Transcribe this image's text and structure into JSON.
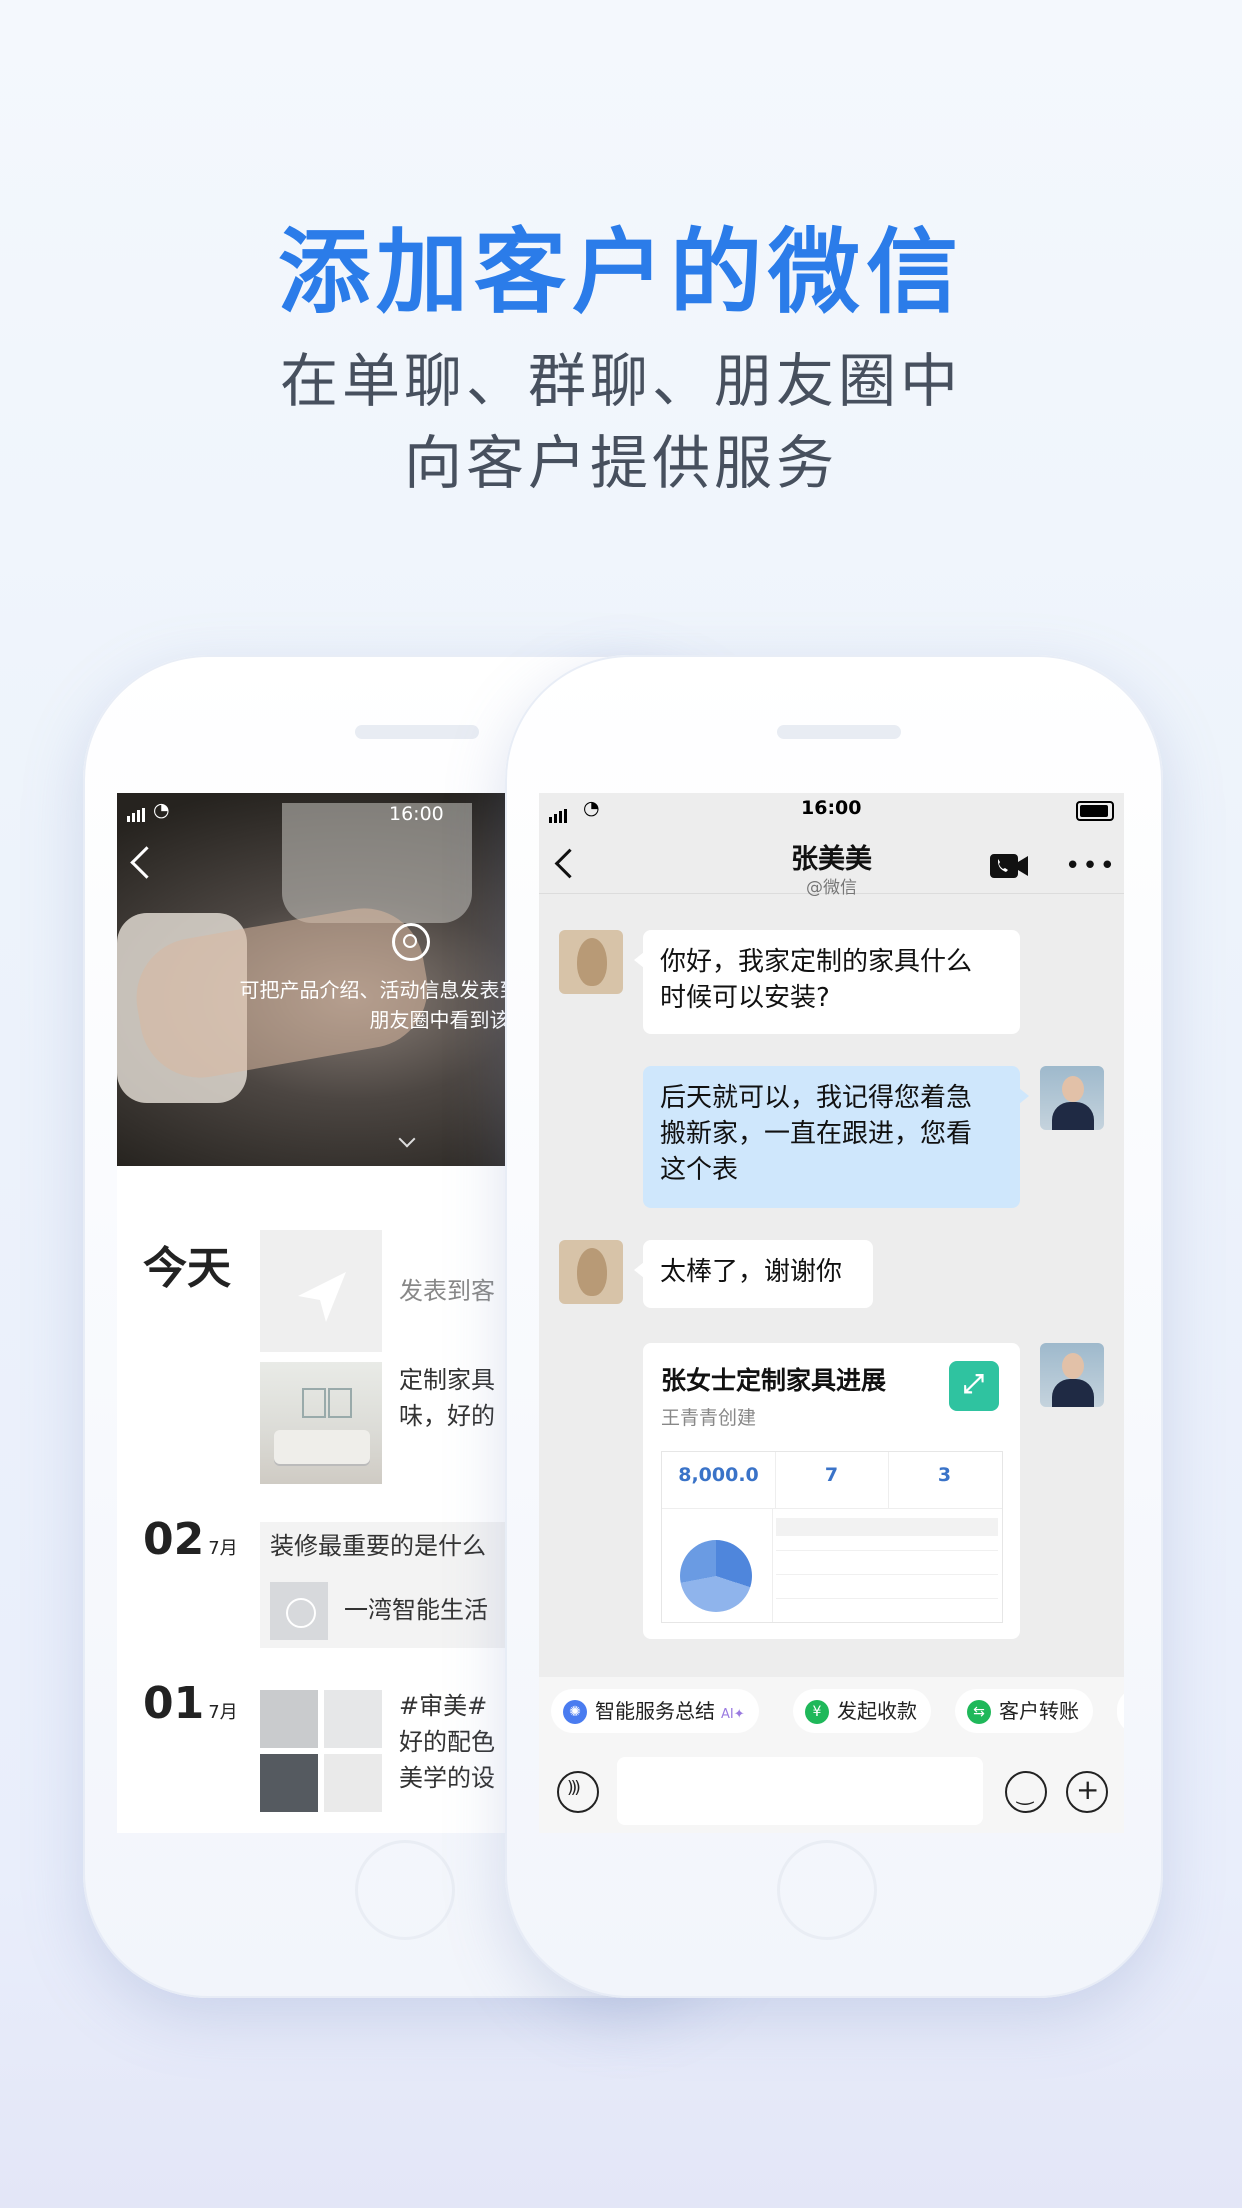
{
  "hero": {
    "title": "添加客户的微信",
    "subtitle_line1": "在单聊、群聊、朋友圈中",
    "subtitle_line2": "向客户提供服务"
  },
  "moments_phone": {
    "status_time": "16:00",
    "cover_caption_line1": "可把产品介绍、活动信息发表到朋友圈",
    "cover_caption_line2": "朋友圈中看到该内容",
    "feed": [
      {
        "day": "今天",
        "text": "发表到客"
      },
      {
        "text_line1": "定制家具",
        "text_line2": "味，好的"
      },
      {
        "day": "02",
        "month": "7月",
        "text": "装修最重要的是什么",
        "video_text": "一湾智能生活"
      },
      {
        "day": "01",
        "month": "7月",
        "text_line1": "#审美#",
        "text_line2": "好的配色",
        "text_line3": "美学的设"
      }
    ]
  },
  "chat_phone": {
    "status_time": "16:00",
    "contact_name": "张美美",
    "contact_source": "@微信",
    "messages": [
      {
        "from": "customer",
        "text_line1": "你好，我家定制的家具什么",
        "text_line2": "时候可以安装?"
      },
      {
        "from": "agent",
        "text_line1": "后天就可以，我记得您着急",
        "text_line2": "搬新家，一直在跟进，您看",
        "text_line3": "这个表"
      },
      {
        "from": "customer",
        "text": "太棒了，谢谢你"
      }
    ],
    "card": {
      "title": "张女士定制家具进展",
      "creator": "王青青创建",
      "stats": [
        {
          "value": "8,000.0"
        },
        {
          "value": "7"
        },
        {
          "value": "3"
        }
      ]
    },
    "quick_actions": [
      {
        "label": "智能服务总结",
        "badge": "AI✦",
        "color": "#4a7cf0"
      },
      {
        "label": "发起收款",
        "color": "#1fb85a"
      },
      {
        "label": "客户转账",
        "color": "#1fb85a"
      }
    ]
  },
  "colors": {
    "accent": "#2b7ce9",
    "agent_bubble": "#cfe7fc",
    "chat_background": "#ededed"
  }
}
